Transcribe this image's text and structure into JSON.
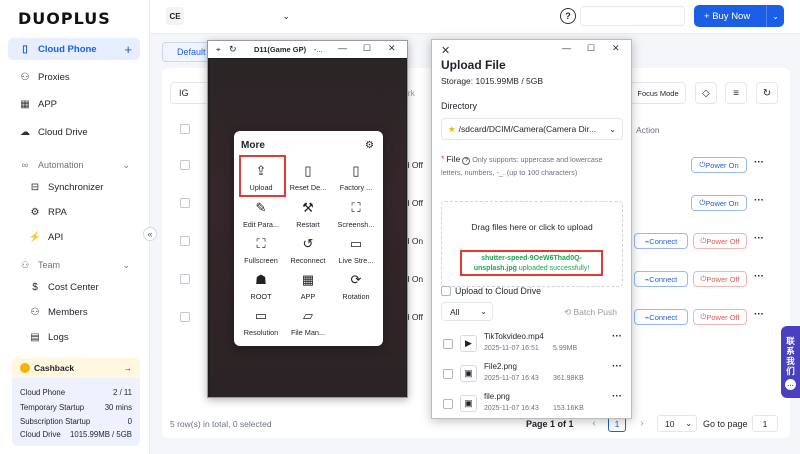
{
  "brand": {
    "logo": "DUOPLUS"
  },
  "sidebar": {
    "cloud_phone": "Cloud Phone",
    "proxies": "Proxies",
    "app": "APP",
    "cloud_drive": "Cloud Drive",
    "automation": "Automation",
    "synchronizer": "Synchronizer",
    "rpa": "RPA",
    "api": "API",
    "team": "Team",
    "cost_center": "Cost Center",
    "members": "Members",
    "logs": "Logs"
  },
  "usage": {
    "cashback": "Cashback",
    "rows": [
      {
        "label": "Cloud Phone",
        "value": "2 / 11"
      },
      {
        "label": "Temporary Startup",
        "value": "30 mins"
      },
      {
        "label": "Subscription Startup",
        "value": "0"
      },
      {
        "label": "Cloud Drive",
        "value": "1015.99MB / 5GB"
      }
    ]
  },
  "topbar": {
    "workspace": "CE",
    "buy_now": "Buy Now"
  },
  "main": {
    "tab_default": "Default",
    "filter_value": "IG",
    "focus_mode": "Focus Mode",
    "col_action": "Action",
    "remark_fragment": "mark",
    "rows": [
      {
        "status": "ed Off",
        "power": "Power On"
      },
      {
        "status": "ed Off",
        "power": "Power On"
      },
      {
        "status": "ed On",
        "connect": "Connect",
        "power": "Power Off"
      },
      {
        "status": "ed On",
        "connect": "Connect",
        "power": "Power Off"
      },
      {
        "status": "ed Off",
        "connect": "Connect",
        "power": "Power Off"
      }
    ],
    "footer_total": "5 row(s) in total, 0 selected",
    "page_info": "Page 1 of 1",
    "page_current": "1",
    "page_size": "10",
    "goto_label": "Go to page",
    "goto_value": "1"
  },
  "phone_window": {
    "title": "D11(Game GP)",
    "title_suffix": "-..."
  },
  "more_panel": {
    "title": "More",
    "items": [
      {
        "label": "Upload",
        "icon": "cloud-upload-icon"
      },
      {
        "label": "Reset De...",
        "icon": "reset-device-icon"
      },
      {
        "label": "Factory ...",
        "icon": "factory-reset-icon"
      },
      {
        "label": "Edit Para...",
        "icon": "edit-params-icon"
      },
      {
        "label": "Restart",
        "icon": "restart-icon"
      },
      {
        "label": "Screensh...",
        "icon": "screenshot-icon"
      },
      {
        "label": "Fullscreen",
        "icon": "fullscreen-icon"
      },
      {
        "label": "Reconnect",
        "icon": "reconnect-icon"
      },
      {
        "label": "Live Stre...",
        "icon": "live-stream-icon"
      },
      {
        "label": "ROOT",
        "icon": "root-icon"
      },
      {
        "label": "APP",
        "icon": "app-grid-icon"
      },
      {
        "label": "Rotation",
        "icon": "rotation-icon"
      },
      {
        "label": "Resolution",
        "icon": "resolution-icon"
      },
      {
        "label": "File Man...",
        "icon": "folder-icon"
      }
    ]
  },
  "upload_dialog": {
    "title": "Upload File",
    "storage": "Storage: 1015.99MB / 5GB",
    "directory_label": "Directory",
    "directory_value": "/sdcard/DCIM/Camera(Camera Dir...",
    "file_label": "File",
    "file_hint": "Only supports: uppercase and lowercase letters, numbers, -_. (up to 100 characters)",
    "drop_text": "Drag files here or click to upload",
    "success_file": "shutter-speed-9OeW6Thad0Q-unsplash.jpg",
    "success_text": "uploaded successfully!",
    "upload_to_cloud": "Upload to Cloud Drive",
    "filter_all": "All",
    "batch_push": "Batch Push",
    "files": [
      {
        "name": "TikTokvideo.mp4",
        "date": "2025-11-07 16:51",
        "size": "5.99MB",
        "icon": "video-file-icon"
      },
      {
        "name": "File2.png",
        "date": "2025-11-07 16:43",
        "size": "361.98KB",
        "icon": "image-file-icon"
      },
      {
        "name": "file.png",
        "date": "2025-11-07 16:43",
        "size": "153.16KB",
        "icon": "image-file-icon"
      }
    ]
  },
  "contact": {
    "chars": [
      "联",
      "系",
      "我",
      "们"
    ]
  },
  "colors": {
    "accent": "#1a5fe6",
    "danger": "#e53935",
    "success": "#22a34a"
  }
}
